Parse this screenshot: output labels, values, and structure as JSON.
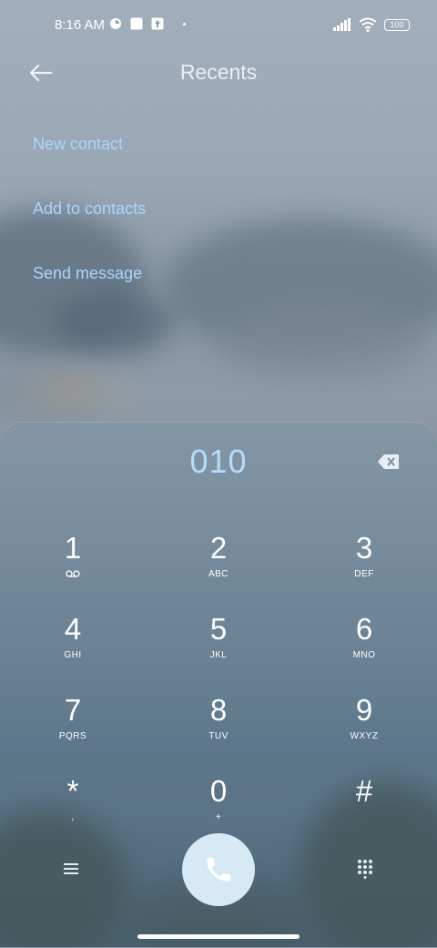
{
  "status_bar": {
    "time": "8:16 AM",
    "battery": "100"
  },
  "header": {
    "title": "Recents"
  },
  "actions": [
    {
      "label": "New contact"
    },
    {
      "label": "Add to contacts"
    },
    {
      "label": "Send message"
    }
  ],
  "dialer": {
    "number": "010",
    "keys": [
      {
        "digit": "1",
        "letters": ""
      },
      {
        "digit": "2",
        "letters": "ABC"
      },
      {
        "digit": "3",
        "letters": "DEF"
      },
      {
        "digit": "4",
        "letters": "GHI"
      },
      {
        "digit": "5",
        "letters": "JKL"
      },
      {
        "digit": "6",
        "letters": "MNO"
      },
      {
        "digit": "7",
        "letters": "PQRS"
      },
      {
        "digit": "8",
        "letters": "TUV"
      },
      {
        "digit": "9",
        "letters": "WXYZ"
      },
      {
        "digit": "*",
        "letters": ","
      },
      {
        "digit": "0",
        "letters": "+"
      },
      {
        "digit": "#",
        "letters": ""
      }
    ]
  },
  "colors": {
    "accent": "#a8d6ff",
    "number": "#b6dcfb",
    "call_button": "#d8e9f6"
  },
  "icons": {
    "back": "arrow-left-icon",
    "backspace": "backspace-icon",
    "voicemail": "voicemail-icon",
    "menu": "menu-icon",
    "call": "phone-icon",
    "keypad": "keypad-icon"
  }
}
